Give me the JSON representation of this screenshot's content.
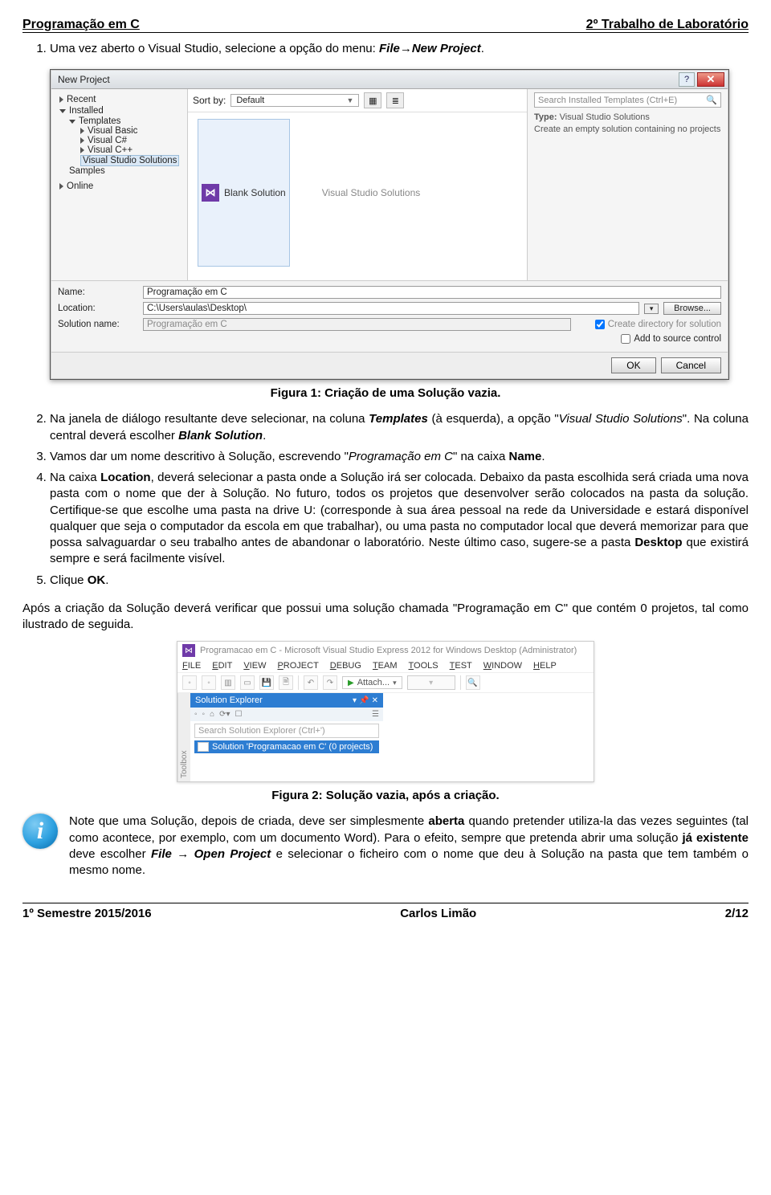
{
  "header": {
    "left": "Programação em C",
    "right": "2º Trabalho de Laboratório"
  },
  "footer": {
    "left": "1º Semestre 2015/2016",
    "center": "Carlos Limão",
    "right": "2/12"
  },
  "steps": {
    "s1_a": "Uma vez aberto o Visual Studio, selecione a opção do menu: ",
    "s1_b1": "File",
    "s1_b2": "New Project",
    "s2_a": "Na janela de diálogo resultante deve selecionar, na coluna ",
    "s2_b": "Templates",
    "s2_c": " (à esquerda), a opção \"",
    "s2_d": "Visual Studio Solutions",
    "s2_e": "\". Na coluna central deverá escolher ",
    "s2_f": "Blank Solution",
    "s2_g": ".",
    "s3_a": "Vamos dar um nome descritivo à Solução, escrevendo \"",
    "s3_b": "Programação em C",
    "s3_c": "\" na caixa ",
    "s3_d": "Name",
    "s3_e": ".",
    "s4_a": "Na caixa ",
    "s4_b": "Location",
    "s4_c": ", deverá selecionar a pasta onde a Solução irá ser colocada. Debaixo da pasta escolhida será criada uma nova pasta com o nome que der à Solução. No futuro, todos os projetos que desenvolver serão colocados na pasta da solução. Certifique-se que escolhe uma pasta na drive U: (corresponde à sua área pessoal na rede da Universidade e estará disponível qualquer que seja o computador da escola em que trabalhar), ou uma pasta no computador local que deverá memorizar para que possa salvaguardar o seu trabalho antes de abandonar o laboratório. Neste último caso, sugere-se a pasta ",
    "s4_d": "Desktop",
    "s4_e": " que existirá sempre e será facilmente visível.",
    "s5_a": "Clique ",
    "s5_b": "OK",
    "s5_c": "."
  },
  "caption1": "Figura 1: Criação de uma Solução vazia.",
  "caption2": "Figura 2: Solução vazia, após a criação.",
  "post_text": "Após a criação da Solução deverá verificar que possui uma solução chamada \"Programação em C\" que contém 0 projetos, tal como ilustrado de seguida.",
  "note": {
    "a": "Note que uma Solução, depois de criada, deve ser simplesmente ",
    "b": "aberta",
    "c": " quando pretender utiliza-la das vezes seguintes (tal como acontece, por exemplo, com um documento Word). Para o efeito, sempre que pretenda abrir uma solução ",
    "d": "já existente",
    "e": " deve escolher ",
    "f": "File",
    "g": " → ",
    "h": "Open Project",
    "i": " e selecionar o ficheiro com o nome que deu à Solução na pasta que tem também o mesmo nome."
  },
  "dlg": {
    "title": "New Project",
    "left": {
      "recent": "Recent",
      "installed": "Installed",
      "templates": "Templates",
      "vb": "Visual Basic",
      "cs": "Visual C#",
      "cpp": "Visual C++",
      "vss": "Visual Studio Solutions",
      "samples": "Samples",
      "online": "Online"
    },
    "center": {
      "sortby": "Sort by:",
      "sort_value": "Default",
      "blank": "Blank Solution",
      "vss": "Visual Studio Solutions"
    },
    "right": {
      "search_placeholder": "Search Installed Templates (Ctrl+E)",
      "type_label": "Type:",
      "type_value": "Visual Studio Solutions",
      "desc": "Create an empty solution containing no projects"
    },
    "form": {
      "name_label": "Name:",
      "name_value": "Programação em C",
      "loc_label": "Location:",
      "loc_value": "C:\\Users\\aulas\\Desktop\\",
      "browse": "Browse...",
      "sol_label": "Solution name:",
      "sol_value": "Programação em C",
      "chk1": "Create directory for solution",
      "chk2": "Add to source control",
      "ok": "OK",
      "cancel": "Cancel"
    }
  },
  "vs": {
    "title": "Programacao em C - Microsoft Visual Studio Express 2012 for Windows Desktop (Administrator)",
    "menu": [
      "FILE",
      "EDIT",
      "VIEW",
      "PROJECT",
      "DEBUG",
      "TEAM",
      "TOOLS",
      "TEST",
      "WINDOW",
      "HELP"
    ],
    "attach": "Attach...",
    "toolbox": "Toolbox",
    "se_title": "Solution Explorer",
    "se_search": "Search Solution Explorer (Ctrl+')",
    "se_item": "Solution 'Programacao em C' (0 projects)"
  }
}
